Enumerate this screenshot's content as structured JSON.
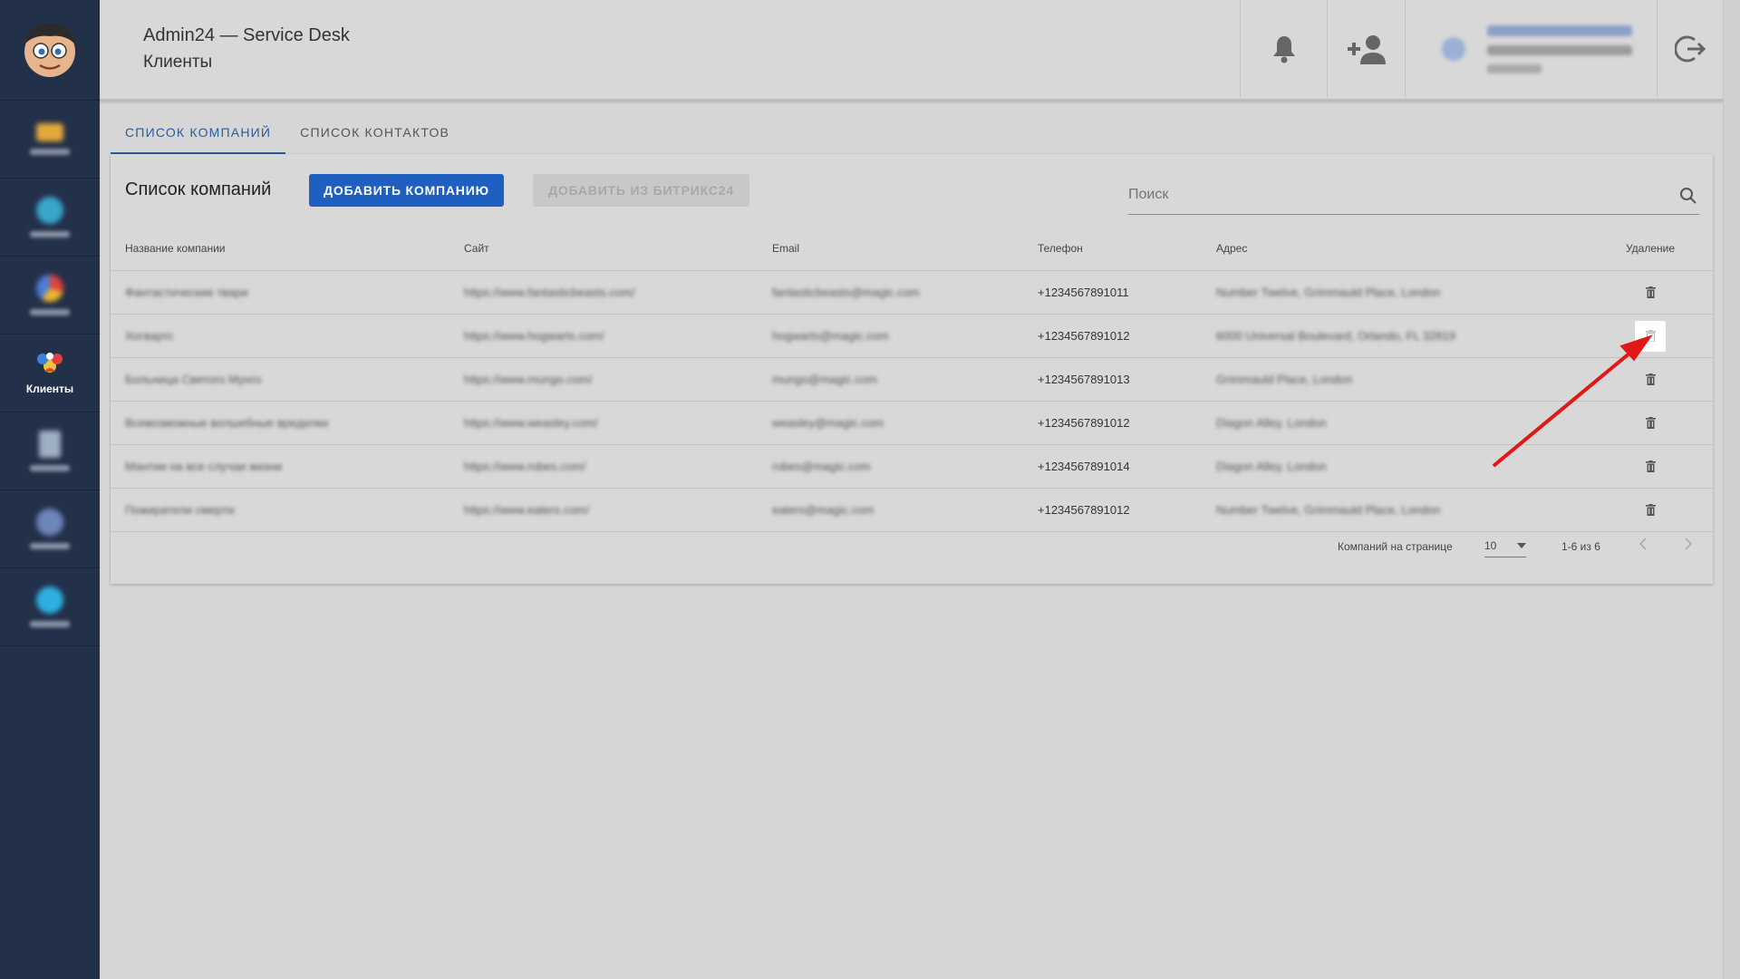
{
  "header": {
    "app_title": "Admin24 — Service Desk",
    "page_title": "Клиенты"
  },
  "sidebar": {
    "items": [
      {
        "icon": "folder-icon",
        "label": ""
      },
      {
        "icon": "globe-icon",
        "label": ""
      },
      {
        "icon": "pie-icon",
        "label": ""
      },
      {
        "icon": "clients-icon",
        "label": "Клиенты",
        "active": true
      },
      {
        "icon": "document-icon",
        "label": ""
      },
      {
        "icon": "settings-icon",
        "label": ""
      },
      {
        "icon": "info-icon",
        "label": ""
      }
    ]
  },
  "tabs": [
    {
      "label": "СПИСОК КОМПАНИЙ",
      "active": true
    },
    {
      "label": "СПИСОК КОНТАКТОВ",
      "active": false
    }
  ],
  "card": {
    "title": "Список компаний",
    "add_button": "ДОБАВИТЬ КОМПАНИЮ",
    "import_button": "ДОБАВИТЬ ИЗ БИТРИКС24",
    "search_placeholder": "Поиск"
  },
  "table": {
    "headers": [
      "Название компании",
      "Сайт",
      "Email",
      "Телефон",
      "Адрес",
      "Удаление"
    ],
    "rows": [
      {
        "name": "Фантастические твари",
        "site": "https://www.fantasticbeasts.com/",
        "email": "fantasticbeasts@magic.com",
        "phone": "+1234567891011",
        "address": "Number Twelve, Grimmauld Place, London"
      },
      {
        "name": "Хогвартс",
        "site": "https://www.hogwarts.com/",
        "email": "hogwarts@magic.com",
        "phone": "+1234567891012",
        "address": "6000 Universal Boulevard, Orlando, FL 32819"
      },
      {
        "name": "Больница Святого Мунго",
        "site": "https://www.mungo.com/",
        "email": "mungo@magic.com",
        "phone": "+1234567891013",
        "address": "Grimmauld Place, London"
      },
      {
        "name": "Всевозможные волшебные вредилки",
        "site": "https://www.weasley.com/",
        "email": "weasley@magic.com",
        "phone": "+1234567891012",
        "address": "Diagon Alley, London"
      },
      {
        "name": "Мантии на все случаи жизни",
        "site": "https://www.robes.com/",
        "email": "robes@magic.com",
        "phone": "+1234567891014",
        "address": "Diagon Alley, London"
      },
      {
        "name": "Пожиратели смерти",
        "site": "https://www.eaters.com/",
        "email": "eaters@magic.com",
        "phone": "+1234567891012",
        "address": "Number Twelve, Grimmauld Place, London"
      }
    ]
  },
  "pagination": {
    "per_page_label": "Компаний на странице",
    "per_page_value": "10",
    "range": "1-6 из 6"
  },
  "colors": {
    "sidebar_bg": "#23304a",
    "primary": "#1f5fbf",
    "tab_active": "#2a5c9a",
    "annotation_arrow": "#e01818"
  }
}
